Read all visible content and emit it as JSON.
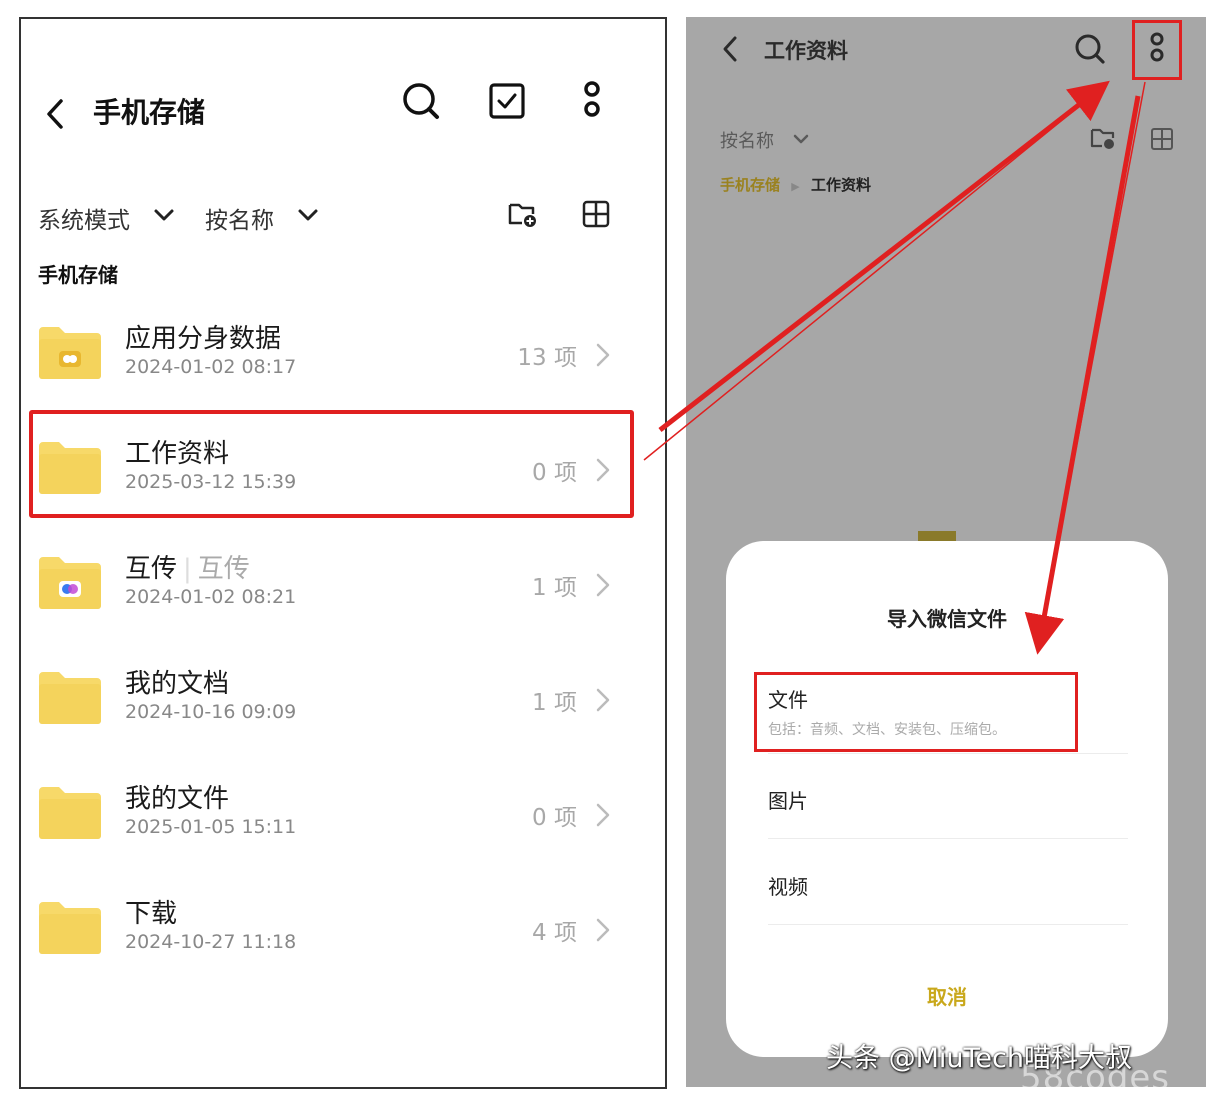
{
  "left": {
    "title": "手机存储",
    "mode_label": "系统模式",
    "sort_label": "按名称",
    "breadcrumb": "手机存储",
    "items": [
      {
        "name": "应用分身数据",
        "date": "2024-01-02 08:17",
        "count": "13 项",
        "icon": "app-clone-folder-icon"
      },
      {
        "name": "工作资料",
        "date": "2025-03-12 15:39",
        "count": "0 项",
        "icon": "folder-icon"
      },
      {
        "name": "互传",
        "sub": "互传",
        "date": "2024-01-02 08:21",
        "count": "1 项",
        "icon": "transfer-folder-icon"
      },
      {
        "name": "我的文档",
        "date": "2024-10-16 09:09",
        "count": "1 项",
        "icon": "folder-icon"
      },
      {
        "name": "我的文件",
        "date": "2025-01-05 15:11",
        "count": "0 项",
        "icon": "folder-icon"
      },
      {
        "name": "下载",
        "date": "2024-10-27 11:18",
        "count": "4 项",
        "icon": "folder-icon"
      }
    ]
  },
  "right": {
    "title": "工作资料",
    "sort_label": "按名称",
    "breadcrumb": [
      "手机存储",
      "工作资料"
    ],
    "sheet": {
      "title": "导入微信文件",
      "options": [
        {
          "label": "文件",
          "desc": "包括：音频、文档、安装包、压缩包。"
        },
        {
          "label": "图片"
        },
        {
          "label": "视频"
        }
      ],
      "cancel": "取消"
    }
  },
  "watermark": "头条 @MiuTech喵科大叔",
  "watermark2": "58codes",
  "colors": {
    "folder": "#f7d969",
    "highlight": "#e02020",
    "accent": "#c9a81c",
    "overlay": "#a7a7a7"
  }
}
